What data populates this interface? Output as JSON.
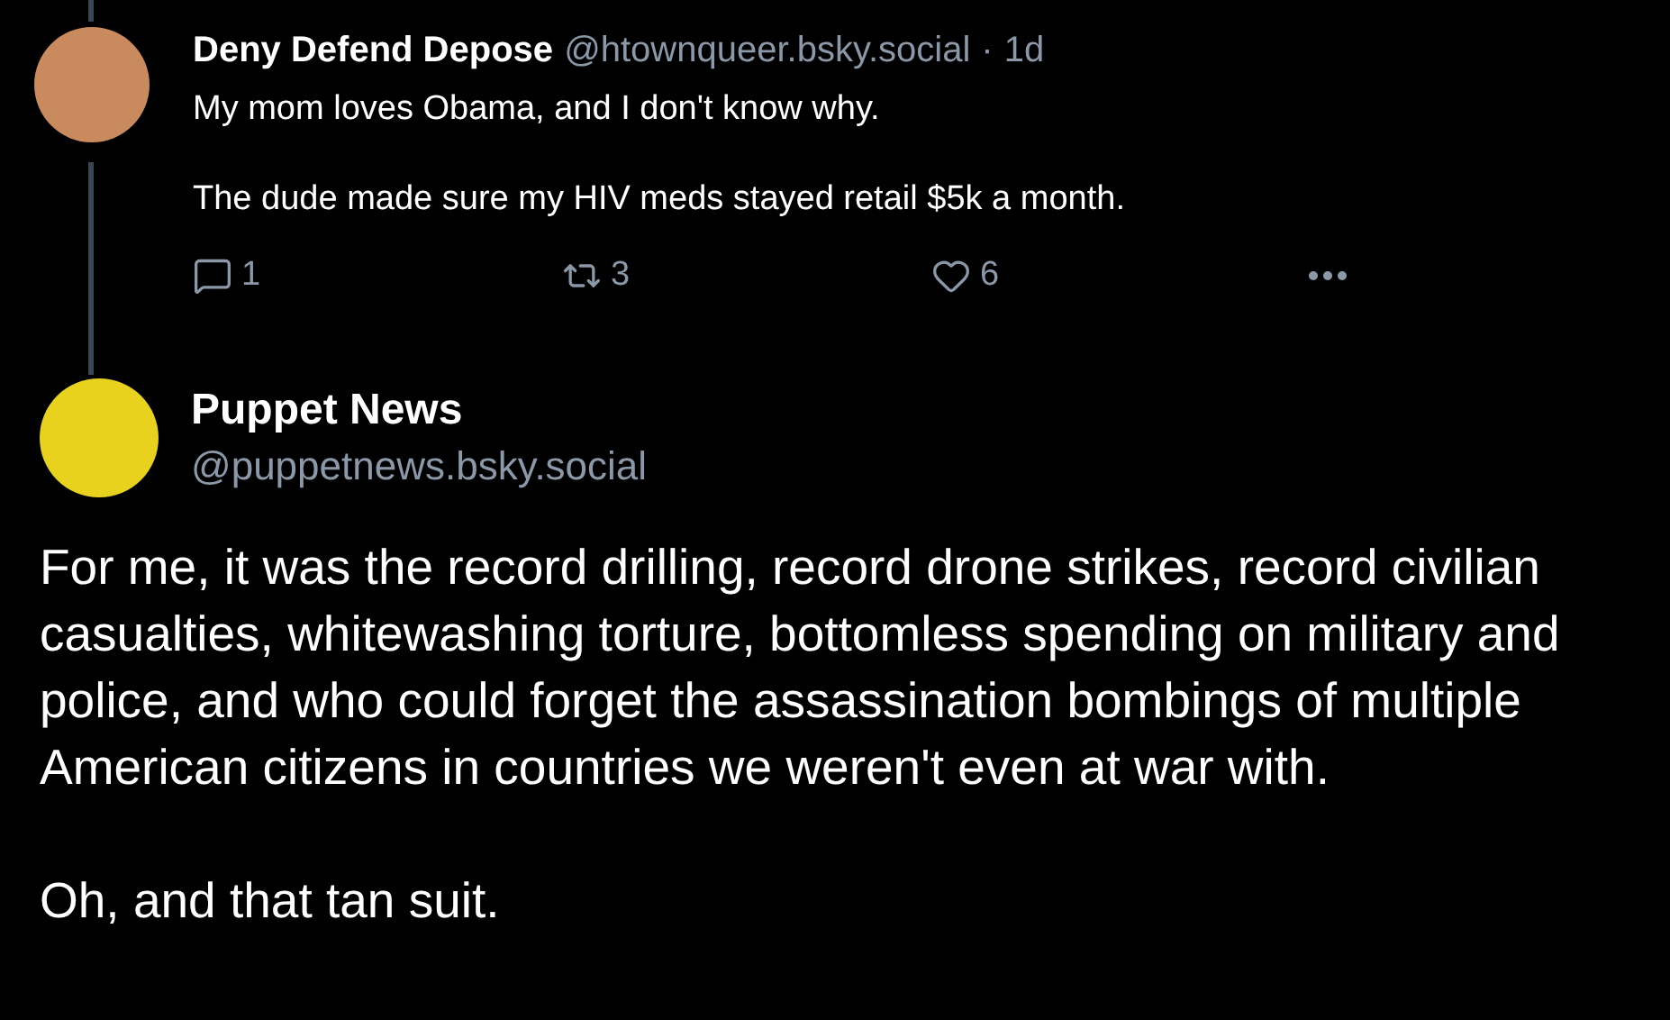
{
  "reply_post": {
    "author": "Deny Defend Depose",
    "handle": "@htownqueer.bsky.social",
    "separator": "·",
    "time": "1d",
    "paragraphs": [
      "My mom loves Obama, and I don't know why.",
      "The dude made sure my HIV meds stayed retail $5k a month."
    ],
    "actions": [
      {
        "kind": "reply",
        "count": "1"
      },
      {
        "kind": "repost",
        "count": "3"
      },
      {
        "kind": "like",
        "count": "6"
      },
      {
        "kind": "more"
      }
    ]
  },
  "main_post": {
    "author": "Puppet News",
    "handle": "@puppetnews.bsky.social",
    "paragraphs": [
      "For me, it was the record drilling, record drone strikes, record civilian casualties, whitewashing torture, bottomless spending on military and police, and who could forget the assassination bombings of multiple American citizens in countries we weren't even at war with.",
      "Oh, and that tan suit."
    ]
  }
}
